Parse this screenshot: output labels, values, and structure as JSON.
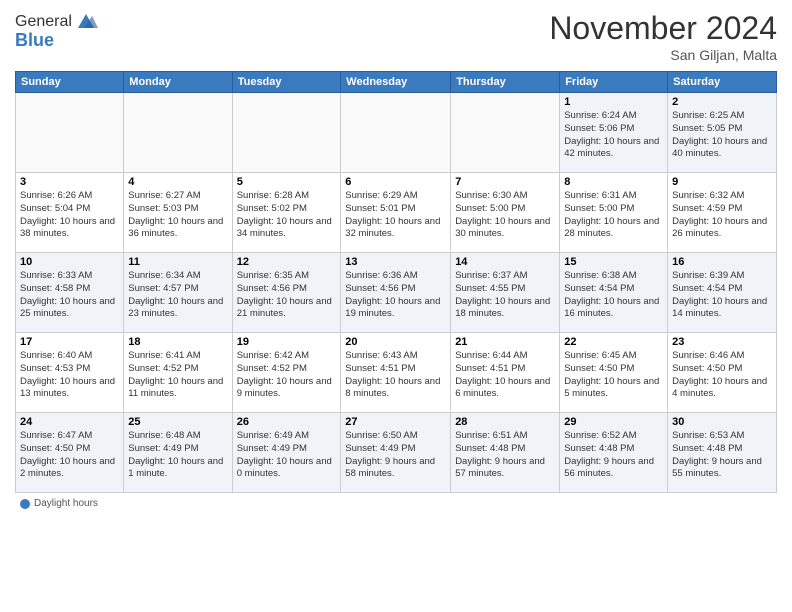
{
  "header": {
    "logo_line1": "General",
    "logo_line2": "Blue",
    "month_title": "November 2024",
    "location": "San Giljan, Malta"
  },
  "weekdays": [
    "Sunday",
    "Monday",
    "Tuesday",
    "Wednesday",
    "Thursday",
    "Friday",
    "Saturday"
  ],
  "weeks": [
    [
      {
        "day": "",
        "info": ""
      },
      {
        "day": "",
        "info": ""
      },
      {
        "day": "",
        "info": ""
      },
      {
        "day": "",
        "info": ""
      },
      {
        "day": "",
        "info": ""
      },
      {
        "day": "1",
        "info": "Sunrise: 6:24 AM\nSunset: 5:06 PM\nDaylight: 10 hours and 42 minutes."
      },
      {
        "day": "2",
        "info": "Sunrise: 6:25 AM\nSunset: 5:05 PM\nDaylight: 10 hours and 40 minutes."
      }
    ],
    [
      {
        "day": "3",
        "info": "Sunrise: 6:26 AM\nSunset: 5:04 PM\nDaylight: 10 hours and 38 minutes."
      },
      {
        "day": "4",
        "info": "Sunrise: 6:27 AM\nSunset: 5:03 PM\nDaylight: 10 hours and 36 minutes."
      },
      {
        "day": "5",
        "info": "Sunrise: 6:28 AM\nSunset: 5:02 PM\nDaylight: 10 hours and 34 minutes."
      },
      {
        "day": "6",
        "info": "Sunrise: 6:29 AM\nSunset: 5:01 PM\nDaylight: 10 hours and 32 minutes."
      },
      {
        "day": "7",
        "info": "Sunrise: 6:30 AM\nSunset: 5:00 PM\nDaylight: 10 hours and 30 minutes."
      },
      {
        "day": "8",
        "info": "Sunrise: 6:31 AM\nSunset: 5:00 PM\nDaylight: 10 hours and 28 minutes."
      },
      {
        "day": "9",
        "info": "Sunrise: 6:32 AM\nSunset: 4:59 PM\nDaylight: 10 hours and 26 minutes."
      }
    ],
    [
      {
        "day": "10",
        "info": "Sunrise: 6:33 AM\nSunset: 4:58 PM\nDaylight: 10 hours and 25 minutes."
      },
      {
        "day": "11",
        "info": "Sunrise: 6:34 AM\nSunset: 4:57 PM\nDaylight: 10 hours and 23 minutes."
      },
      {
        "day": "12",
        "info": "Sunrise: 6:35 AM\nSunset: 4:56 PM\nDaylight: 10 hours and 21 minutes."
      },
      {
        "day": "13",
        "info": "Sunrise: 6:36 AM\nSunset: 4:56 PM\nDaylight: 10 hours and 19 minutes."
      },
      {
        "day": "14",
        "info": "Sunrise: 6:37 AM\nSunset: 4:55 PM\nDaylight: 10 hours and 18 minutes."
      },
      {
        "day": "15",
        "info": "Sunrise: 6:38 AM\nSunset: 4:54 PM\nDaylight: 10 hours and 16 minutes."
      },
      {
        "day": "16",
        "info": "Sunrise: 6:39 AM\nSunset: 4:54 PM\nDaylight: 10 hours and 14 minutes."
      }
    ],
    [
      {
        "day": "17",
        "info": "Sunrise: 6:40 AM\nSunset: 4:53 PM\nDaylight: 10 hours and 13 minutes."
      },
      {
        "day": "18",
        "info": "Sunrise: 6:41 AM\nSunset: 4:52 PM\nDaylight: 10 hours and 11 minutes."
      },
      {
        "day": "19",
        "info": "Sunrise: 6:42 AM\nSunset: 4:52 PM\nDaylight: 10 hours and 9 minutes."
      },
      {
        "day": "20",
        "info": "Sunrise: 6:43 AM\nSunset: 4:51 PM\nDaylight: 10 hours and 8 minutes."
      },
      {
        "day": "21",
        "info": "Sunrise: 6:44 AM\nSunset: 4:51 PM\nDaylight: 10 hours and 6 minutes."
      },
      {
        "day": "22",
        "info": "Sunrise: 6:45 AM\nSunset: 4:50 PM\nDaylight: 10 hours and 5 minutes."
      },
      {
        "day": "23",
        "info": "Sunrise: 6:46 AM\nSunset: 4:50 PM\nDaylight: 10 hours and 4 minutes."
      }
    ],
    [
      {
        "day": "24",
        "info": "Sunrise: 6:47 AM\nSunset: 4:50 PM\nDaylight: 10 hours and 2 minutes."
      },
      {
        "day": "25",
        "info": "Sunrise: 6:48 AM\nSunset: 4:49 PM\nDaylight: 10 hours and 1 minute."
      },
      {
        "day": "26",
        "info": "Sunrise: 6:49 AM\nSunset: 4:49 PM\nDaylight: 10 hours and 0 minutes."
      },
      {
        "day": "27",
        "info": "Sunrise: 6:50 AM\nSunset: 4:49 PM\nDaylight: 9 hours and 58 minutes."
      },
      {
        "day": "28",
        "info": "Sunrise: 6:51 AM\nSunset: 4:48 PM\nDaylight: 9 hours and 57 minutes."
      },
      {
        "day": "29",
        "info": "Sunrise: 6:52 AM\nSunset: 4:48 PM\nDaylight: 9 hours and 56 minutes."
      },
      {
        "day": "30",
        "info": "Sunrise: 6:53 AM\nSunset: 4:48 PM\nDaylight: 9 hours and 55 minutes."
      }
    ]
  ],
  "legend": {
    "daylight_label": "Daylight hours"
  }
}
